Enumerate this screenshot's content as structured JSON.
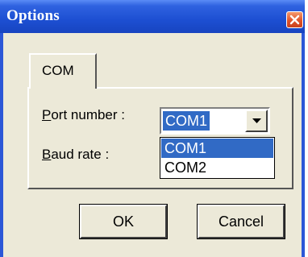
{
  "window": {
    "title": "Options"
  },
  "tabs": [
    {
      "label": "COM"
    }
  ],
  "form": {
    "port_label_first": "P",
    "port_label_rest": "ort number :",
    "baud_label_first": "B",
    "baud_label_rest": "aud rate :",
    "port_value": "COM1"
  },
  "dropdown": {
    "options": [
      "COM1",
      "COM2"
    ],
    "selected": "COM1"
  },
  "buttons": {
    "ok": "OK",
    "cancel": "Cancel"
  },
  "colors": {
    "title_bar": "#2354d4",
    "selection": "#316ac5",
    "dialog_bg": "#ece9d8",
    "close_button": "#e0532a"
  }
}
